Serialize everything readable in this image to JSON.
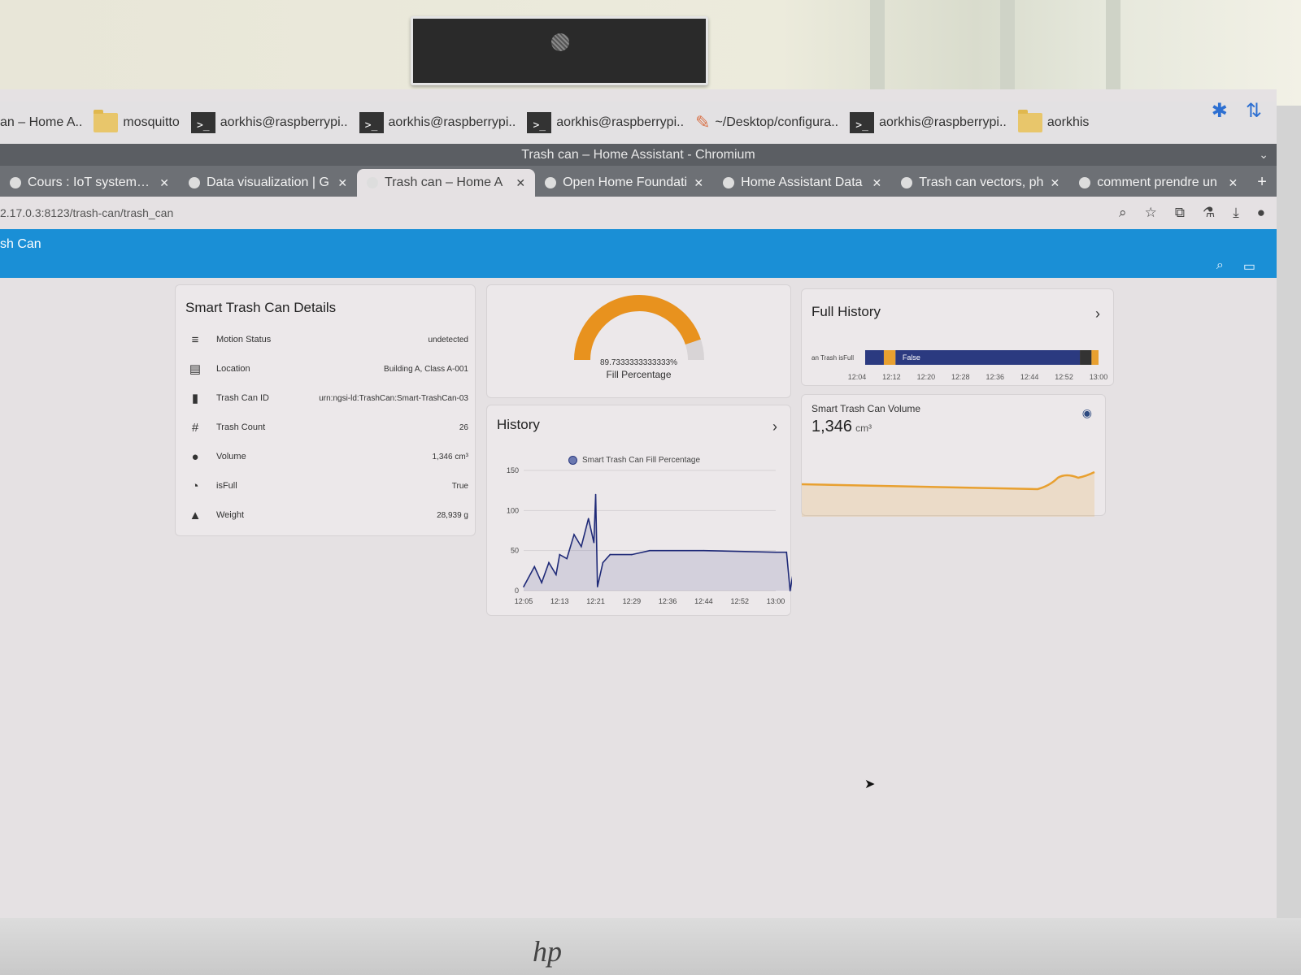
{
  "taskbar": {
    "items": [
      {
        "icon": "none",
        "label": "an – Home A.."
      },
      {
        "icon": "folder-icon",
        "label": "mosquitto"
      },
      {
        "icon": "terminal-icon",
        "label": "aorkhis@raspberrypi.."
      },
      {
        "icon": "terminal-icon",
        "label": "aorkhis@raspberrypi.."
      },
      {
        "icon": "terminal-icon",
        "label": "aorkhis@raspberrypi.."
      },
      {
        "icon": "pencil-icon",
        "label": "~/Desktop/configura.."
      },
      {
        "icon": "terminal-icon",
        "label": "aorkhis@raspberrypi.."
      },
      {
        "icon": "folder-icon",
        "label": "aorkhis"
      }
    ],
    "terminal_glyph": ">_"
  },
  "window": {
    "title": "Trash can – Home Assistant - Chromium"
  },
  "tabs": [
    {
      "label": "Cours : IoT system de",
      "active": false
    },
    {
      "label": "Data visualization | G",
      "active": false
    },
    {
      "label": "Trash can – Home A",
      "active": true
    },
    {
      "label": "Open Home Foundati",
      "active": false
    },
    {
      "label": "Home Assistant Data",
      "active": false
    },
    {
      "label": "Trash can vectors, ph",
      "active": false
    },
    {
      "label": "comment prendre un",
      "active": false
    }
  ],
  "address": {
    "url": "2.17.0.3:8123/trash-can/trash_can"
  },
  "ha": {
    "title": "sh Can",
    "accent": "#1a8fd6"
  },
  "details": {
    "title": "Smart Trash Can Details",
    "rows": [
      {
        "icon": "motion-icon",
        "label": "Motion Status",
        "value": "undetected"
      },
      {
        "icon": "location-icon",
        "label": "Location",
        "value": "Building A, Class A-001"
      },
      {
        "icon": "trash-icon",
        "label": "Trash Can ID",
        "value": "urn:ngsi-ld:TrashCan:Smart-TrashCan-03"
      },
      {
        "icon": "count-icon",
        "label": "Trash Count",
        "value": "26"
      },
      {
        "icon": "volume-icon",
        "label": "Volume",
        "value": "1,346 cm³"
      },
      {
        "icon": "full-icon",
        "label": "isFull",
        "value": "True"
      },
      {
        "icon": "weight-icon",
        "label": "Weight",
        "value": "28,939 g"
      }
    ]
  },
  "gauge": {
    "value": 89.7333333333333,
    "value_text": "89.7333333333333%",
    "name": "Fill Percentage",
    "color": "#e8921e"
  },
  "history": {
    "title": "History",
    "chevron": "›"
  },
  "full_history": {
    "title": "Full History",
    "chevron": "›",
    "entity_label": "an Trash isFull",
    "state_label": "False",
    "x_ticks": [
      "12:04",
      "12:12",
      "12:20",
      "12:28",
      "12:36",
      "12:44",
      "12:52",
      "13:00"
    ]
  },
  "volume": {
    "name": "Smart Trash Can Volume",
    "value": "1,346",
    "unit": "cm³",
    "line_color": "#e8a030"
  },
  "chart_data": {
    "type": "line",
    "title": "",
    "legend": "Smart Trash Can Fill Percentage",
    "x": [
      "12:05",
      "12:13",
      "12:21",
      "12:29",
      "12:36",
      "12:44",
      "12:52",
      "13:00"
    ],
    "y_ticks": [
      "0",
      "50",
      "100",
      "150"
    ],
    "ylim": [
      0,
      150
    ],
    "series": [
      {
        "name": "Smart Trash Can Fill Percentage",
        "color": "#1f2a78",
        "points": [
          [
            0,
            5
          ],
          [
            0.3,
            30
          ],
          [
            0.5,
            10
          ],
          [
            0.7,
            35
          ],
          [
            0.9,
            20
          ],
          [
            1.0,
            45
          ],
          [
            1.2,
            40
          ],
          [
            1.4,
            70
          ],
          [
            1.6,
            55
          ],
          [
            1.8,
            90
          ],
          [
            1.95,
            60
          ],
          [
            2.0,
            120
          ],
          [
            2.05,
            5
          ],
          [
            2.2,
            35
          ],
          [
            2.4,
            45
          ],
          [
            3.0,
            45
          ],
          [
            3.5,
            50
          ],
          [
            5.0,
            50
          ],
          [
            7.0,
            48
          ],
          [
            7.3,
            48
          ],
          [
            7.4,
            0
          ],
          [
            7.55,
            40
          ],
          [
            7.7,
            70
          ],
          [
            7.85,
            75
          ]
        ]
      }
    ]
  }
}
